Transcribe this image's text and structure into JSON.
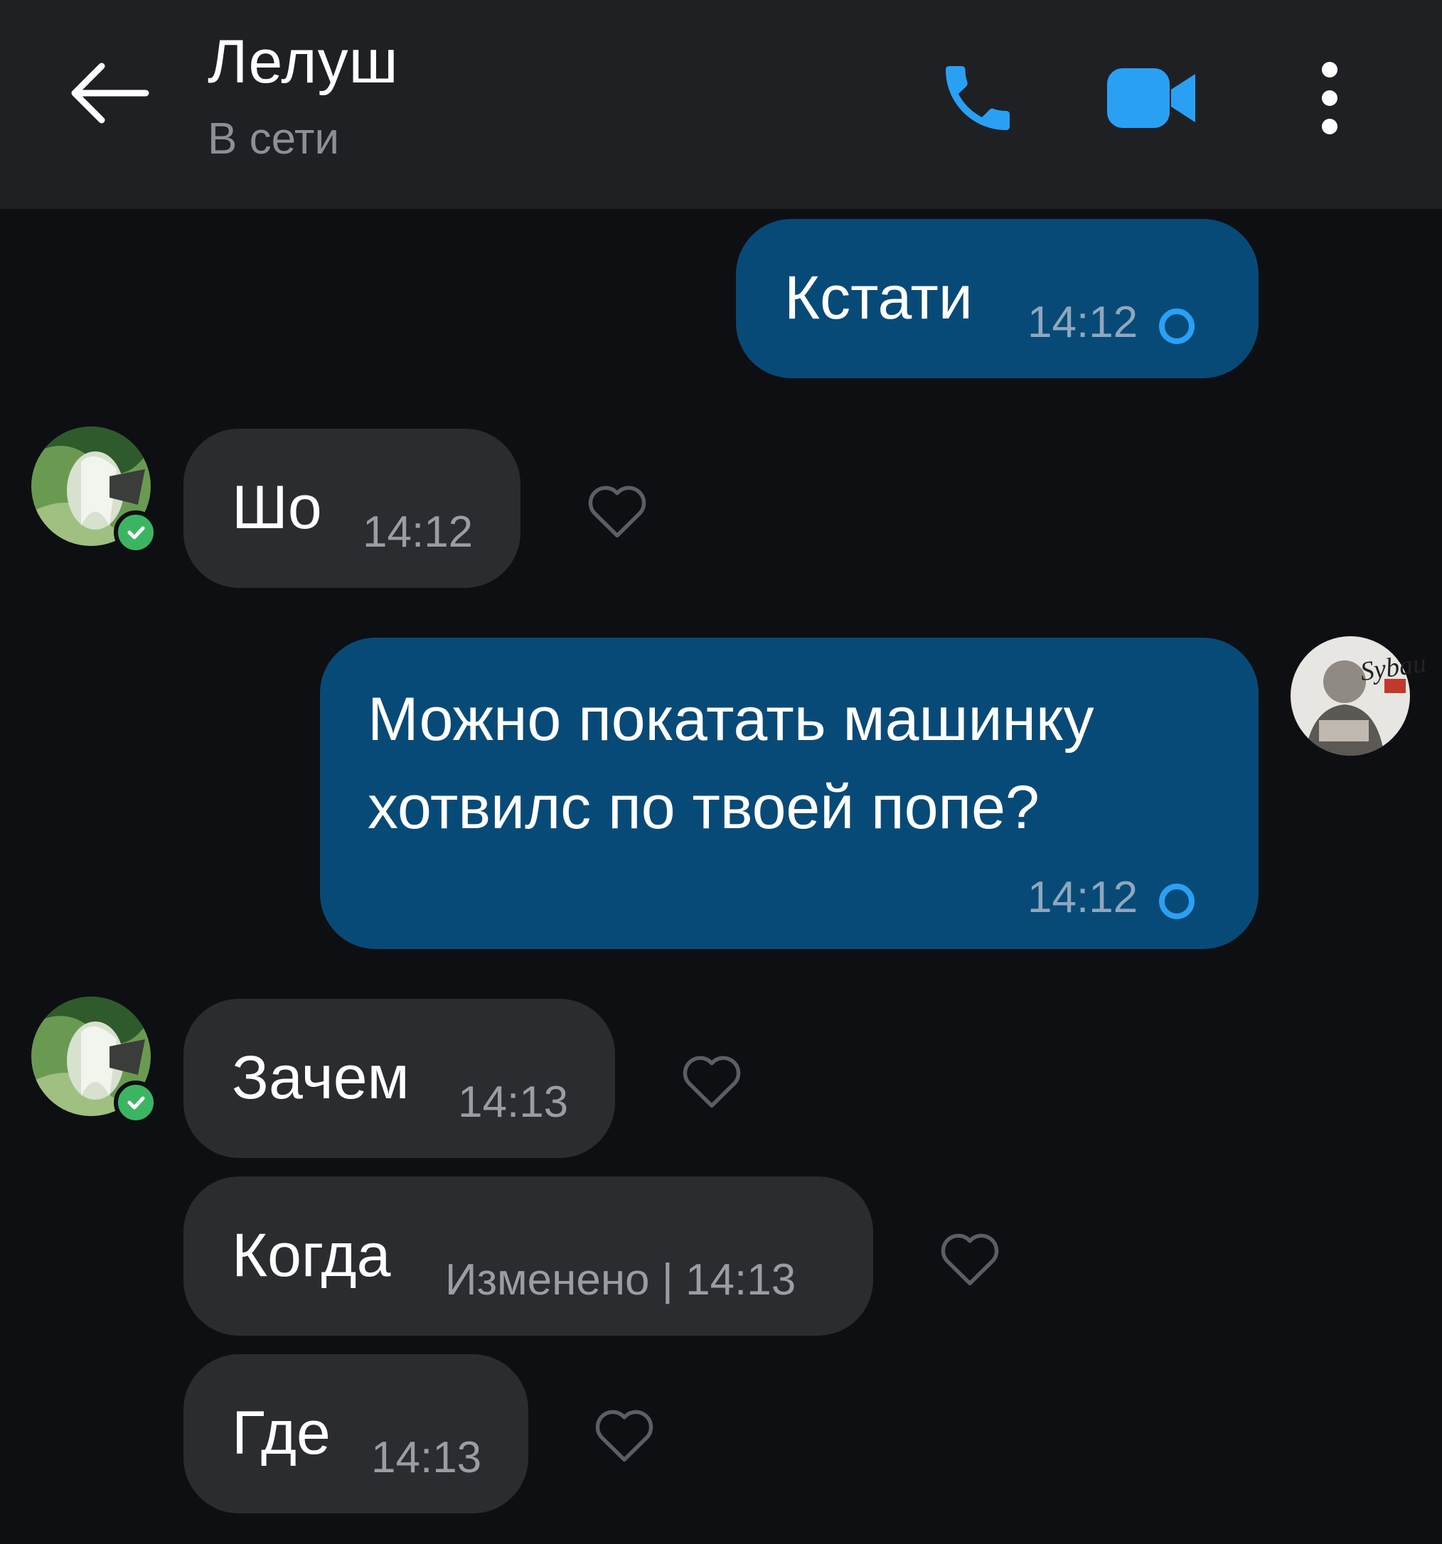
{
  "header": {
    "title": "Лелуш",
    "status": "В сети",
    "icons": [
      "back-arrow-icon",
      "phone-icon",
      "video-camera-icon",
      "more-vertical-icon"
    ],
    "accent_color": "#2aa0f5"
  },
  "messages": [
    {
      "direction": "outgoing",
      "text": "Кстати",
      "time": "14:12",
      "status_icon": "sending-ring-icon"
    },
    {
      "direction": "incoming",
      "text": "Шо",
      "time": "14:12",
      "avatar": "contact-avatar",
      "verified": true
    },
    {
      "direction": "outgoing",
      "text_lines": [
        "Можно покатать машинку",
        "хотвилс по твоей попе?"
      ],
      "time": "14:12",
      "status_icon": "sending-ring-icon",
      "avatar": "my-avatar",
      "avatar_text": "Sybau"
    },
    {
      "direction": "incoming",
      "text": "Зачем",
      "time": "14:13",
      "avatar": "contact-avatar",
      "verified": true
    },
    {
      "direction": "incoming",
      "text": "Когда",
      "time": "Изменено | 14:13"
    },
    {
      "direction": "incoming",
      "text": "Где",
      "time": "14:13"
    }
  ],
  "colors": {
    "background": "#0e0f13",
    "header_bg": "#1f2024",
    "outgoing_bubble": "#084a77",
    "incoming_bubble": "#2b2c30",
    "verified_badge": "#3cb563"
  }
}
